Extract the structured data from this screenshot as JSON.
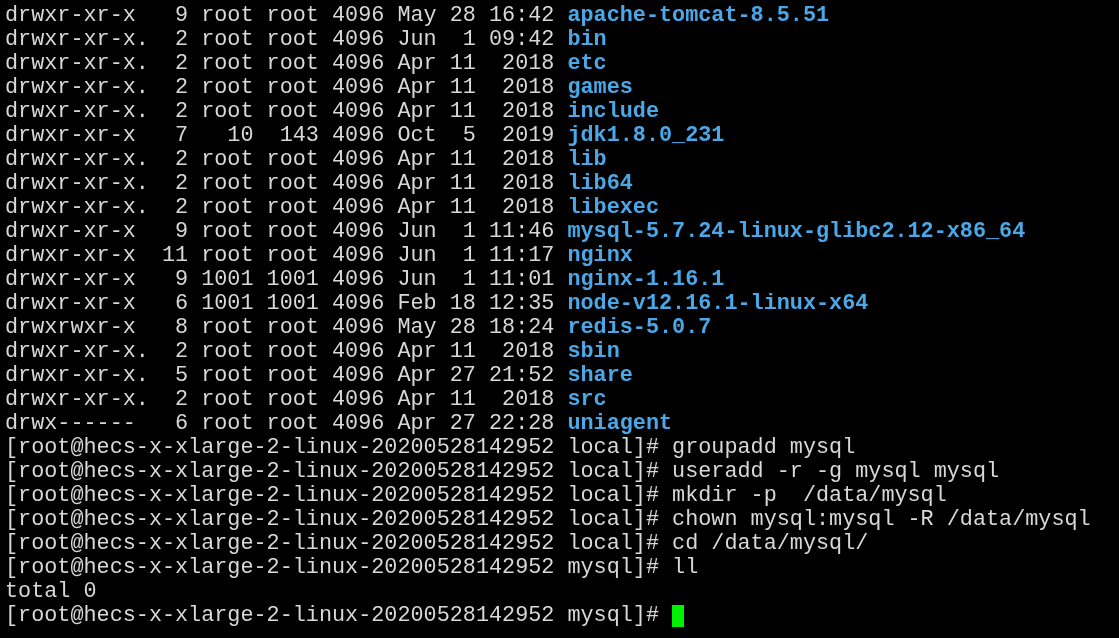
{
  "listing": [
    {
      "info": "drwxr-xr-x   9 root root 4096 May 28 16:42",
      "name": "apache-tomcat-8.5.51"
    },
    {
      "info": "drwxr-xr-x.  2 root root 4096 Jun  1 09:42",
      "name": "bin"
    },
    {
      "info": "drwxr-xr-x.  2 root root 4096 Apr 11  2018",
      "name": "etc"
    },
    {
      "info": "drwxr-xr-x.  2 root root 4096 Apr 11  2018",
      "name": "games"
    },
    {
      "info": "drwxr-xr-x.  2 root root 4096 Apr 11  2018",
      "name": "include"
    },
    {
      "info": "drwxr-xr-x   7   10  143 4096 Oct  5  2019",
      "name": "jdk1.8.0_231"
    },
    {
      "info": "drwxr-xr-x.  2 root root 4096 Apr 11  2018",
      "name": "lib"
    },
    {
      "info": "drwxr-xr-x.  2 root root 4096 Apr 11  2018",
      "name": "lib64"
    },
    {
      "info": "drwxr-xr-x.  2 root root 4096 Apr 11  2018",
      "name": "libexec"
    },
    {
      "info": "drwxr-xr-x   9 root root 4096 Jun  1 11:46",
      "name": "mysql-5.7.24-linux-glibc2.12-x86_64"
    },
    {
      "info": "drwxr-xr-x  11 root root 4096 Jun  1 11:17",
      "name": "nginx"
    },
    {
      "info": "drwxr-xr-x   9 1001 1001 4096 Jun  1 11:01",
      "name": "nginx-1.16.1"
    },
    {
      "info": "drwxr-xr-x   6 1001 1001 4096 Feb 18 12:35",
      "name": "node-v12.16.1-linux-x64"
    },
    {
      "info": "drwxrwxr-x   8 root root 4096 May 28 18:24",
      "name": "redis-5.0.7"
    },
    {
      "info": "drwxr-xr-x.  2 root root 4096 Apr 11  2018",
      "name": "sbin"
    },
    {
      "info": "drwxr-xr-x.  5 root root 4096 Apr 27 21:52",
      "name": "share"
    },
    {
      "info": "drwxr-xr-x.  2 root root 4096 Apr 11  2018",
      "name": "src"
    },
    {
      "info": "drwx------   6 root root 4096 Apr 27 22:28",
      "name": "uniagent"
    }
  ],
  "session": [
    {
      "kind": "command",
      "prompt": "[root@hecs-x-xlarge-2-linux-20200528142952 local]#",
      "command": "groupadd mysql"
    },
    {
      "kind": "command",
      "prompt": "[root@hecs-x-xlarge-2-linux-20200528142952 local]#",
      "command": "useradd -r -g mysql mysql"
    },
    {
      "kind": "command",
      "prompt": "[root@hecs-x-xlarge-2-linux-20200528142952 local]#",
      "command": "mkdir -p  /data/mysql"
    },
    {
      "kind": "command",
      "prompt": "[root@hecs-x-xlarge-2-linux-20200528142952 local]#",
      "command": "chown mysql:mysql -R /data/mysql"
    },
    {
      "kind": "command",
      "prompt": "[root@hecs-x-xlarge-2-linux-20200528142952 local]#",
      "command": "cd /data/mysql/"
    },
    {
      "kind": "command",
      "prompt": "[root@hecs-x-xlarge-2-linux-20200528142952 mysql]#",
      "command": "ll"
    },
    {
      "kind": "output",
      "text": "total 0"
    },
    {
      "kind": "cursor",
      "prompt": "[root@hecs-x-xlarge-2-linux-20200528142952 mysql]#"
    }
  ]
}
